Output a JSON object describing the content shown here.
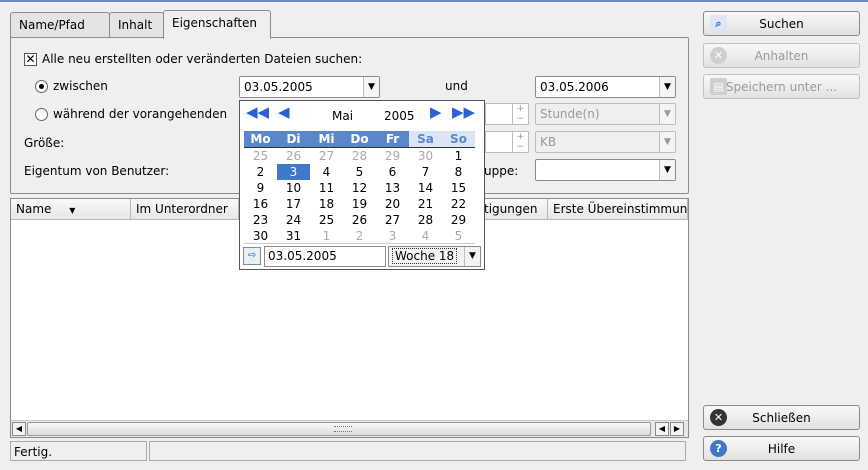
{
  "tabs": [
    "Name/Pfad",
    "Inhalt",
    "Eigenschaften"
  ],
  "form": {
    "all_files_label": "Alle neu erstellten oder veränderten Dateien suchen:",
    "between_label": "zwischen",
    "from_date": "03.05.2005",
    "and_label": "und",
    "to_date": "03.05.2006",
    "during_label": "während der vorangehenden",
    "unit_value": "Stunde(n)",
    "size_label": "Größe:",
    "size_unit": "KB",
    "owner_user_label": "Eigentum von Benutzer:",
    "group_label_visible": "uppe:",
    "spin_plus": "+",
    "spin_minus": "−"
  },
  "buttons": {
    "search": "Suchen",
    "stop": "Anhalten",
    "save_as": "Speichern unter ...",
    "close": "Schließen",
    "help": "Hilfe"
  },
  "list": {
    "columns": [
      "Name",
      "Im Unterordner",
      "tigungen",
      "Erste Übereinstimmung"
    ],
    "sort_indicator": "▼"
  },
  "status": {
    "text": "Fertig.",
    "secondary": ""
  },
  "calendar": {
    "month": "Mai",
    "year": "2005",
    "weekdays": [
      "Mo",
      "Di",
      "Mi",
      "Do",
      "Fr",
      "Sa",
      "So"
    ],
    "weeks": [
      [
        {
          "d": "25",
          "o": true
        },
        {
          "d": "26",
          "o": true
        },
        {
          "d": "27",
          "o": true
        },
        {
          "d": "28",
          "o": true
        },
        {
          "d": "29",
          "o": true
        },
        {
          "d": "30",
          "o": true
        },
        {
          "d": "1",
          "o": false
        }
      ],
      [
        {
          "d": "2",
          "o": false
        },
        {
          "d": "3",
          "o": false,
          "s": true
        },
        {
          "d": "4",
          "o": false
        },
        {
          "d": "5",
          "o": false
        },
        {
          "d": "6",
          "o": false
        },
        {
          "d": "7",
          "o": false
        },
        {
          "d": "8",
          "o": false
        }
      ],
      [
        {
          "d": "9",
          "o": false
        },
        {
          "d": "10",
          "o": false
        },
        {
          "d": "11",
          "o": false
        },
        {
          "d": "12",
          "o": false
        },
        {
          "d": "13",
          "o": false
        },
        {
          "d": "14",
          "o": false
        },
        {
          "d": "15",
          "o": false
        }
      ],
      [
        {
          "d": "16",
          "o": false
        },
        {
          "d": "17",
          "o": false
        },
        {
          "d": "18",
          "o": false
        },
        {
          "d": "19",
          "o": false
        },
        {
          "d": "20",
          "o": false
        },
        {
          "d": "21",
          "o": false
        },
        {
          "d": "22",
          "o": false
        }
      ],
      [
        {
          "d": "23",
          "o": false
        },
        {
          "d": "24",
          "o": false
        },
        {
          "d": "25",
          "o": false
        },
        {
          "d": "26",
          "o": false
        },
        {
          "d": "27",
          "o": false
        },
        {
          "d": "28",
          "o": false
        },
        {
          "d": "29",
          "o": false
        }
      ],
      [
        {
          "d": "30",
          "o": false
        },
        {
          "d": "31",
          "o": false
        },
        {
          "d": "1",
          "o": true
        },
        {
          "d": "2",
          "o": true
        },
        {
          "d": "3",
          "o": true
        },
        {
          "d": "4",
          "o": true
        },
        {
          "d": "5",
          "o": true
        }
      ]
    ],
    "date_input": "03.05.2005",
    "week_label": "Woche 18"
  },
  "colors": {
    "accent": "#3f77c9",
    "header_bar": "#5a86cc"
  }
}
